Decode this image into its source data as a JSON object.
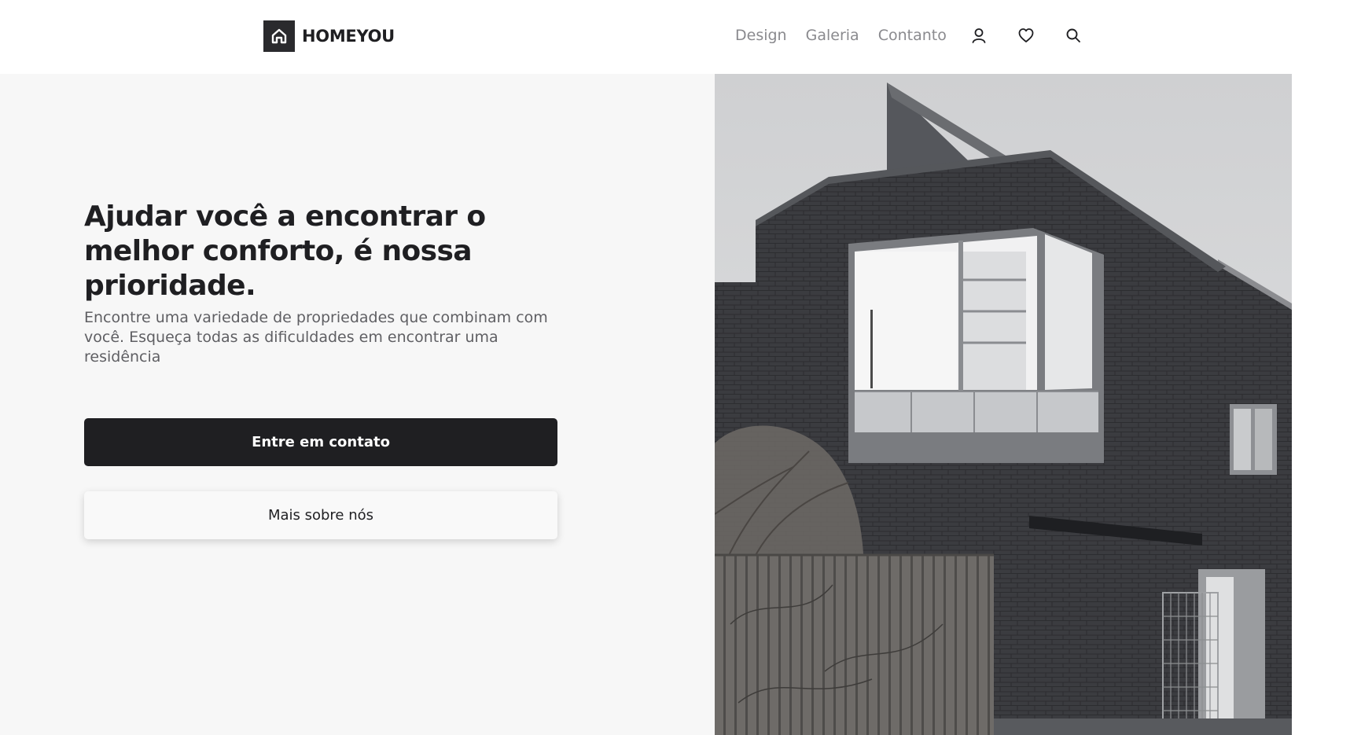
{
  "brand": {
    "name": "HOMEYOU",
    "logo_icon": "house-icon"
  },
  "nav": {
    "links": [
      "Design",
      "Galeria",
      "Contanto"
    ],
    "icons": [
      "user-icon",
      "heart-icon",
      "search-icon"
    ]
  },
  "hero": {
    "headline": "Ajudar você a encontrar o melhor conforto, é nossa prioridade.",
    "description": "Encontre uma variedade de propriedades que combinam com você. Esqueça todas as dificuldades em encontrar uma residência",
    "primary_button": "Entre em contato",
    "secondary_button": "Mais sobre nós"
  },
  "colors": {
    "dark": "#1f1f22",
    "muted_text": "#5f5f63",
    "nav_text": "#8a8a8e",
    "panel_bg": "#f7f7f7"
  }
}
